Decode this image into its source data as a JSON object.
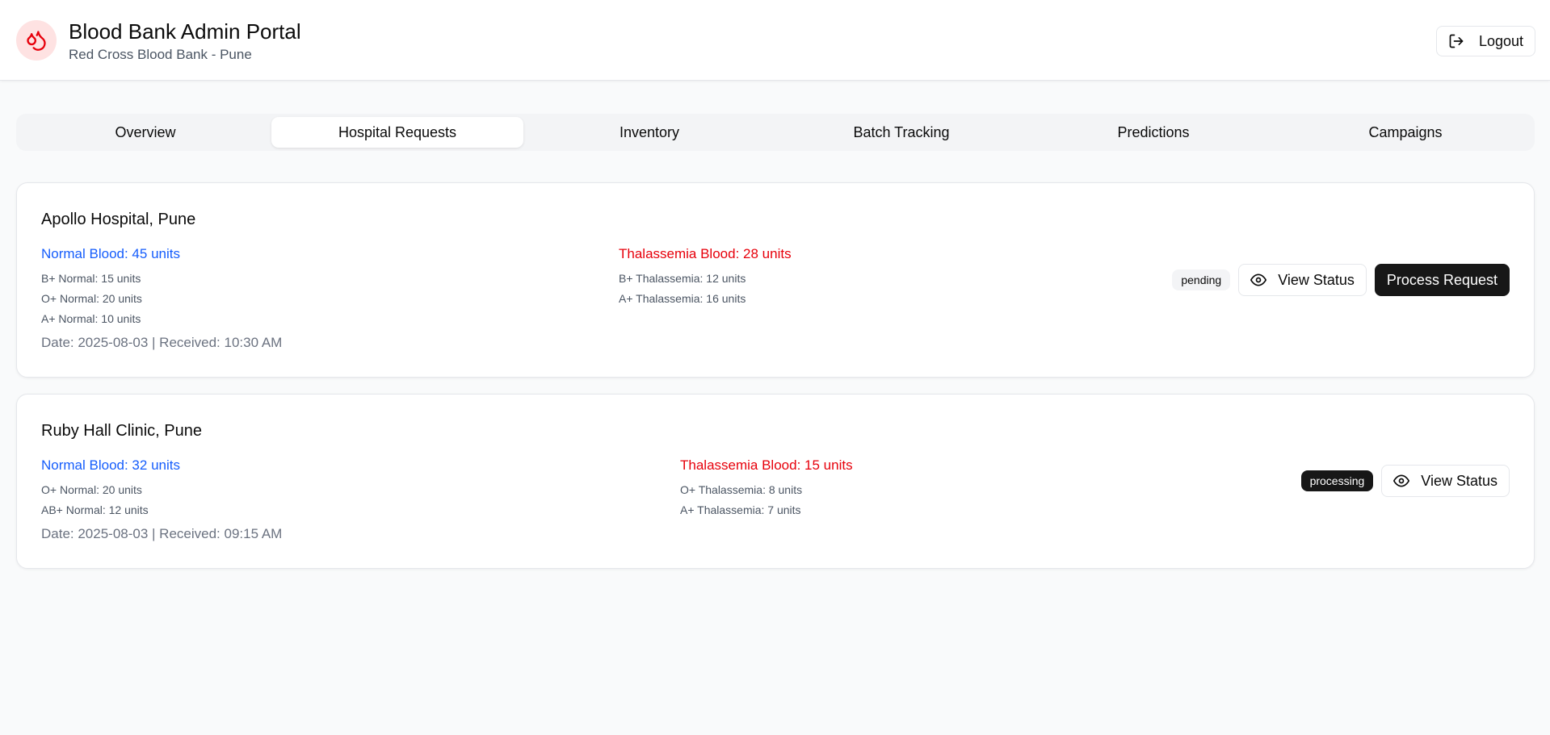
{
  "header": {
    "title": "Blood Bank Admin Portal",
    "subtitle": "Red Cross Blood Bank - Pune",
    "logout_label": "Logout",
    "logo_icon": "droplets-icon",
    "accent_color": "#e7000b"
  },
  "tabs": [
    {
      "label": "Overview",
      "active": false
    },
    {
      "label": "Hospital Requests",
      "active": true
    },
    {
      "label": "Inventory",
      "active": false
    },
    {
      "label": "Batch Tracking",
      "active": false
    },
    {
      "label": "Predictions",
      "active": false
    },
    {
      "label": "Campaigns",
      "active": false
    }
  ],
  "requests": [
    {
      "hospital": "Apollo Hospital, Pune",
      "normal": {
        "heading": "Normal Blood: 45 units",
        "items": [
          "B+ Normal: 15 units",
          "O+ Normal: 20 units",
          "A+ Normal: 10 units"
        ]
      },
      "thalassemia": {
        "heading": "Thalassemia Blood: 28 units",
        "items": [
          "B+ Thalassemia: 12 units",
          "A+ Thalassemia: 16 units"
        ]
      },
      "date_line": "Date: 2025-08-03 | Received: 10:30 AM",
      "status": "pending",
      "view_label": "View Status",
      "process_label": "Process Request"
    },
    {
      "hospital": "Ruby Hall Clinic, Pune",
      "normal": {
        "heading": "Normal Blood: 32 units",
        "items": [
          "O+ Normal: 20 units",
          "AB+ Normal: 12 units"
        ]
      },
      "thalassemia": {
        "heading": "Thalassemia Blood: 15 units",
        "items": [
          "O+ Thalassemia: 8 units",
          "A+ Thalassemia: 7 units"
        ]
      },
      "date_line": "Date: 2025-08-03 | Received: 09:15 AM",
      "status": "processing",
      "view_label": "View Status"
    }
  ],
  "colors": {
    "normal_blood": "#155dfc",
    "thalassemia_blood": "#e7000b",
    "primary_button": "#171717"
  }
}
